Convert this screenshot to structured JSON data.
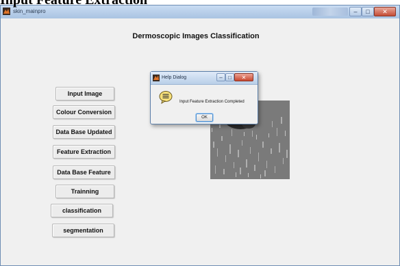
{
  "caption": "Input Feature Extraction",
  "window": {
    "title": "skin_mainpro",
    "controls": {
      "minimize": "–",
      "maximize": "□",
      "close": "✕"
    }
  },
  "main": {
    "heading": "Dermoscopic Images Classification",
    "buttons": [
      {
        "label": "Input Image"
      },
      {
        "label": "Colour Conversion"
      },
      {
        "label": "Data Base Updated"
      },
      {
        "label": "Feature Extraction"
      },
      {
        "label": "Data Base Feature"
      },
      {
        "label": "Trainning"
      },
      {
        "label": "classification"
      },
      {
        "label": "segmentation"
      }
    ]
  },
  "dialog": {
    "title": "Help Dialog",
    "message": "Input Feature Extraction Completed",
    "ok_label": "OK",
    "controls": {
      "minimize": "–",
      "maximize": "□",
      "close": "✕"
    }
  },
  "colors": {
    "window_bg": "#f0f0f0",
    "titlebar": "#b9cfe8",
    "close_button": "#c8472f",
    "image_panel": "#888888"
  }
}
